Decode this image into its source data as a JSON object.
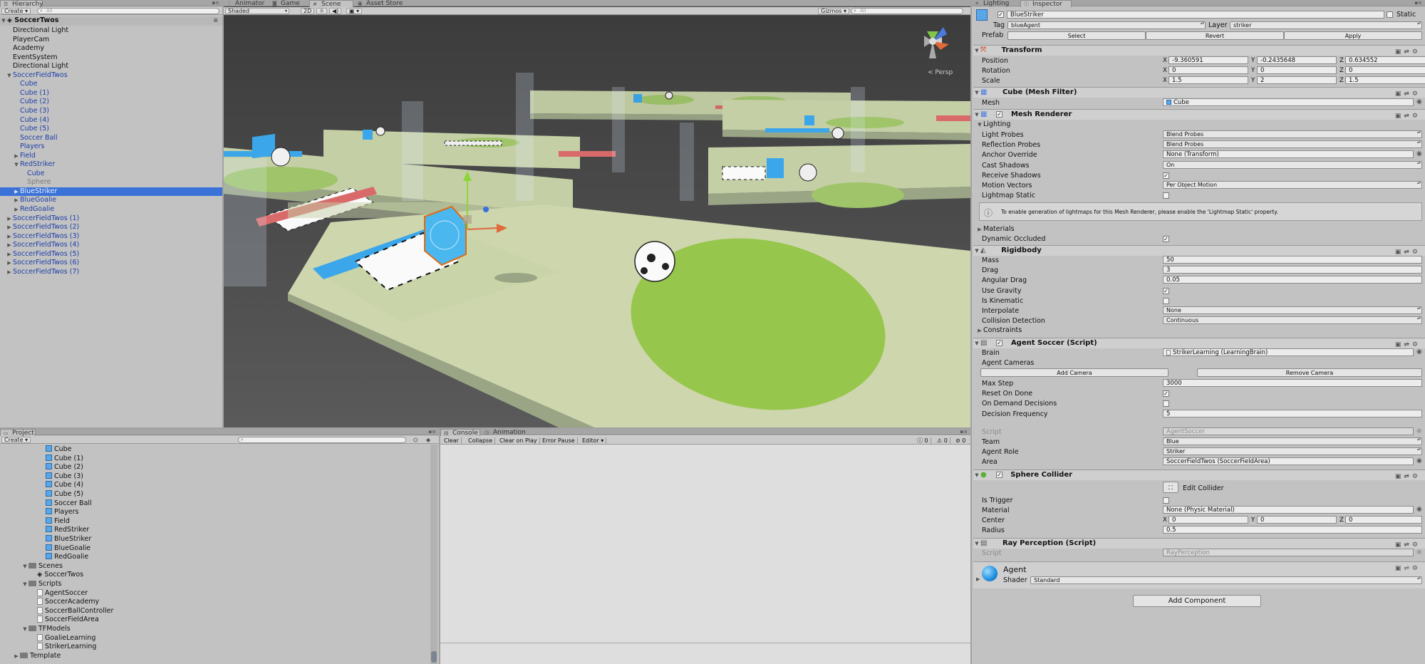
{
  "hierarchy": {
    "tab": "Hierarchy",
    "create": "Create",
    "search_placeholder": "All",
    "scene": "SoccerTwos",
    "items": [
      {
        "label": "Directional Light",
        "indent": 1,
        "style": "normal"
      },
      {
        "label": "PlayerCam",
        "indent": 1,
        "style": "normal"
      },
      {
        "label": "Academy",
        "indent": 1,
        "style": "normal"
      },
      {
        "label": "EventSystem",
        "indent": 1,
        "style": "normal"
      },
      {
        "label": "Directional Light",
        "indent": 1,
        "style": "normal"
      },
      {
        "label": "SoccerFieldTwos",
        "indent": 1,
        "style": "prefab",
        "arrow": "open"
      },
      {
        "label": "Cube",
        "indent": 2,
        "style": "prefab"
      },
      {
        "label": "Cube (1)",
        "indent": 2,
        "style": "prefab"
      },
      {
        "label": "Cube (2)",
        "indent": 2,
        "style": "prefab"
      },
      {
        "label": "Cube (3)",
        "indent": 2,
        "style": "prefab"
      },
      {
        "label": "Cube (4)",
        "indent": 2,
        "style": "prefab"
      },
      {
        "label": "Cube (5)",
        "indent": 2,
        "style": "prefab"
      },
      {
        "label": "Soccer Ball",
        "indent": 2,
        "style": "prefab"
      },
      {
        "label": "Players",
        "indent": 2,
        "style": "prefab"
      },
      {
        "label": "Field",
        "indent": 2,
        "style": "prefab",
        "arrow": "closed"
      },
      {
        "label": "RedStriker",
        "indent": 2,
        "style": "prefab",
        "arrow": "open"
      },
      {
        "label": "Cube",
        "indent": 3,
        "style": "prefab"
      },
      {
        "label": "Sphere",
        "indent": 3,
        "style": "gray"
      },
      {
        "label": "BlueStriker",
        "indent": 2,
        "style": "sel",
        "arrow": "closed"
      },
      {
        "label": "BlueGoalie",
        "indent": 2,
        "style": "prefab",
        "arrow": "closed"
      },
      {
        "label": "RedGoalie",
        "indent": 2,
        "style": "prefab",
        "arrow": "closed"
      },
      {
        "label": "SoccerFieldTwos (1)",
        "indent": 1,
        "style": "prefab",
        "arrow": "closed"
      },
      {
        "label": "SoccerFieldTwos (2)",
        "indent": 1,
        "style": "prefab",
        "arrow": "closed"
      },
      {
        "label": "SoccerFieldTwos (3)",
        "indent": 1,
        "style": "prefab",
        "arrow": "closed"
      },
      {
        "label": "SoccerFieldTwos (4)",
        "indent": 1,
        "style": "prefab",
        "arrow": "closed"
      },
      {
        "label": "SoccerFieldTwos (5)",
        "indent": 1,
        "style": "prefab",
        "arrow": "closed"
      },
      {
        "label": "SoccerFieldTwos (6)",
        "indent": 1,
        "style": "prefab",
        "arrow": "closed"
      },
      {
        "label": "SoccerFieldTwos (7)",
        "indent": 1,
        "style": "prefab",
        "arrow": "closed"
      }
    ]
  },
  "scene_view": {
    "tabs": [
      "Animator",
      "Game",
      "Scene",
      "Asset Store"
    ],
    "active_tab": "Scene",
    "shading": "Shaded",
    "mode_2d": "2D",
    "gizmos": "Gizmos",
    "search_placeholder": "All",
    "persp": "Persp"
  },
  "project": {
    "tab": "Project",
    "create": "Create",
    "items": [
      {
        "label": "Cube",
        "indent": 4,
        "icon": "cube"
      },
      {
        "label": "Cube (1)",
        "indent": 4,
        "icon": "cube"
      },
      {
        "label": "Cube (2)",
        "indent": 4,
        "icon": "cube"
      },
      {
        "label": "Cube (3)",
        "indent": 4,
        "icon": "cube"
      },
      {
        "label": "Cube (4)",
        "indent": 4,
        "icon": "cube"
      },
      {
        "label": "Cube (5)",
        "indent": 4,
        "icon": "cube"
      },
      {
        "label": "Soccer Ball",
        "indent": 4,
        "icon": "cube"
      },
      {
        "label": "Players",
        "indent": 4,
        "icon": "cube"
      },
      {
        "label": "Field",
        "indent": 4,
        "icon": "cube"
      },
      {
        "label": "RedStriker",
        "indent": 4,
        "icon": "cube"
      },
      {
        "label": "BlueStriker",
        "indent": 4,
        "icon": "cube"
      },
      {
        "label": "BlueGoalie",
        "indent": 4,
        "icon": "cube"
      },
      {
        "label": "RedGoalie",
        "indent": 4,
        "icon": "cube"
      },
      {
        "label": "Scenes",
        "indent": 2,
        "icon": "folder",
        "arrow": "open"
      },
      {
        "label": "SoccerTwos",
        "indent": 3,
        "icon": "unity"
      },
      {
        "label": "Scripts",
        "indent": 2,
        "icon": "folder",
        "arrow": "open"
      },
      {
        "label": "AgentSoccer",
        "indent": 3,
        "icon": "file"
      },
      {
        "label": "SoccerAcademy",
        "indent": 3,
        "icon": "file"
      },
      {
        "label": "SoccerBallController",
        "indent": 3,
        "icon": "file"
      },
      {
        "label": "SoccerFieldArea",
        "indent": 3,
        "icon": "file"
      },
      {
        "label": "TFModels",
        "indent": 2,
        "icon": "folder",
        "arrow": "open"
      },
      {
        "label": "GoalieLearning",
        "indent": 3,
        "icon": "file"
      },
      {
        "label": "StrikerLearning",
        "indent": 3,
        "icon": "file"
      },
      {
        "label": "Template",
        "indent": 1,
        "icon": "folder",
        "arrow": "closed"
      }
    ]
  },
  "console": {
    "tabs": [
      "Console",
      "Animation"
    ],
    "buttons": [
      "Clear",
      "Collapse",
      "Clear on Play",
      "Error Pause",
      "Editor"
    ],
    "counts": [
      "0",
      "0",
      "0"
    ]
  },
  "inspector": {
    "tabs": [
      "Lighting",
      "Inspector"
    ],
    "object_name": "BlueStriker",
    "static_label": "Static",
    "tag_label": "Tag",
    "tag_value": "blueAgent",
    "layer_label": "Layer",
    "layer_value": "striker",
    "prefab_label": "Prefab",
    "prefab_buttons": [
      "Select",
      "Revert",
      "Apply"
    ],
    "transform": {
      "title": "Transform",
      "rows": [
        {
          "label": "Position",
          "x": "-9.360591",
          "y": "-0.2435648",
          "z": "0.634552"
        },
        {
          "label": "Rotation",
          "x": "0",
          "y": "0",
          "z": "0"
        },
        {
          "label": "Scale",
          "x": "1.5",
          "y": "2",
          "z": "1.5"
        }
      ]
    },
    "mesh_filter": {
      "title": "Cube (Mesh Filter)",
      "mesh_label": "Mesh",
      "mesh_value": "Cube"
    },
    "mesh_renderer": {
      "title": "Mesh Renderer",
      "lighting": "Lighting",
      "rows": [
        {
          "label": "Light Probes",
          "value": "Blend Probes",
          "kind": "dd"
        },
        {
          "label": "Reflection Probes",
          "value": "Blend Probes",
          "kind": "dd"
        },
        {
          "label": "Anchor Override",
          "value": "None (Transform)",
          "kind": "obj"
        },
        {
          "label": "Cast Shadows",
          "value": "On",
          "kind": "dd"
        },
        {
          "label": "Receive Shadows",
          "value": "✓",
          "kind": "chk"
        },
        {
          "label": "Motion Vectors",
          "value": "Per Object Motion",
          "kind": "dd"
        },
        {
          "label": "Lightmap Static",
          "value": "",
          "kind": "chk"
        }
      ],
      "info": "To enable generation of lightmaps for this Mesh Renderer, please enable the 'Lightmap Static' property.",
      "materials": "Materials",
      "dynamic_occluded": "Dynamic Occluded",
      "dynamic_occluded_value": "✓"
    },
    "rigidbody": {
      "title": "Rigidbody",
      "rows": [
        {
          "label": "Mass",
          "value": "50",
          "kind": "fld"
        },
        {
          "label": "Drag",
          "value": "3",
          "kind": "fld"
        },
        {
          "label": "Angular Drag",
          "value": "0.05",
          "kind": "fld"
        },
        {
          "label": "Use Gravity",
          "value": "✓",
          "kind": "chk"
        },
        {
          "label": "Is Kinematic",
          "value": "",
          "kind": "chk"
        },
        {
          "label": "Interpolate",
          "value": "None",
          "kind": "dd"
        },
        {
          "label": "Collision Detection",
          "value": "Continuous",
          "kind": "dd"
        }
      ],
      "constraints": "Constraints"
    },
    "agent_soccer": {
      "title": "Agent Soccer (Script)",
      "brain_label": "Brain",
      "brain_value": "StrikerLearning (LearningBrain)",
      "agent_cameras": "Agent Cameras",
      "add_camera": "Add Camera",
      "remove_camera": "Remove Camera",
      "rows": [
        {
          "label": "Max Step",
          "value": "3000",
          "kind": "fld"
        },
        {
          "label": "Reset On Done",
          "value": "✓",
          "kind": "chk"
        },
        {
          "label": "On Demand Decisions",
          "value": "",
          "kind": "chk"
        },
        {
          "label": "Decision Frequency",
          "value": "5",
          "kind": "fld"
        }
      ],
      "script_label": "Script",
      "script_value": "AgentSoccer",
      "rows2": [
        {
          "label": "Team",
          "value": "Blue",
          "kind": "dd"
        },
        {
          "label": "Agent Role",
          "value": "Striker",
          "kind": "dd"
        },
        {
          "label": "Area",
          "value": "SoccerFieldTwos (SoccerFieldArea)",
          "kind": "obj"
        }
      ]
    },
    "sphere_collider": {
      "title": "Sphere Collider",
      "edit_collider": "Edit Collider",
      "is_trigger": "Is Trigger",
      "material_label": "Material",
      "material_value": "None (Physic Material)",
      "center_label": "Center",
      "center": {
        "x": "0",
        "y": "0",
        "z": "0"
      },
      "radius_label": "Radius",
      "radius_value": "0.5"
    },
    "ray_perception": {
      "title": "Ray Perception (Script)",
      "script_label": "Script",
      "script_value": "RayPerception"
    },
    "material": {
      "name": "Agent",
      "shader_label": "Shader",
      "shader_value": "Standard"
    },
    "add_component": "Add Component"
  },
  "colors": {
    "selection": "#3a72d8",
    "prefab_text": "#1c3fa8",
    "field_green": "#c9d6a9",
    "blue_agent": "#3ba7ea",
    "red_goal": "#d96a6a"
  }
}
